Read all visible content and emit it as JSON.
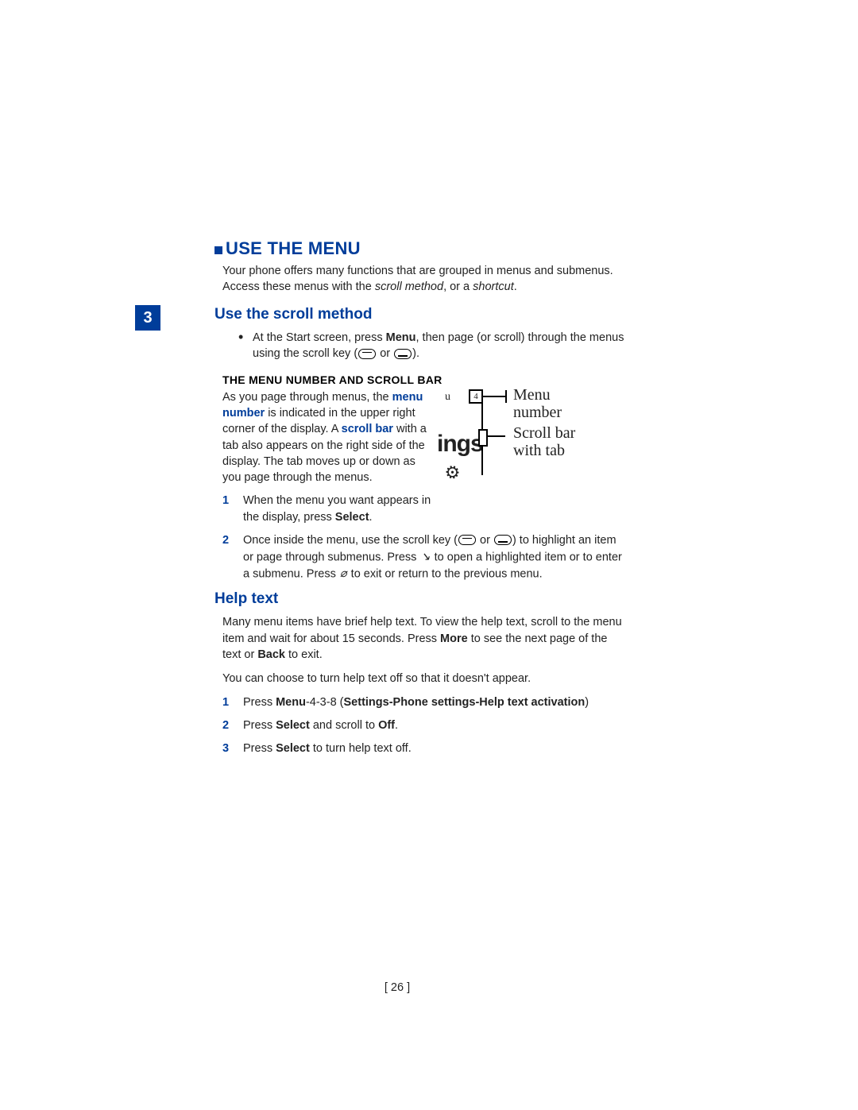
{
  "chapter_number": "3",
  "h1": "USE THE MENU",
  "intro_a": "Your phone offers many functions that are grouped in menus and submenus. Access these menus with the ",
  "intro_scroll": "scroll method",
  "intro_or": ", or a ",
  "intro_shortcut": "shortcut",
  "intro_dot": ".",
  "h2a": "Use the scroll method",
  "bullet1_a": "At the Start screen, press ",
  "bullet1_menu": "Menu",
  "bullet1_b": ", then page (or scroll) through the menus using the scroll key (",
  "bullet1_or": " or ",
  "bullet1_end": ").",
  "h3a": "THE MENU NUMBER AND SCROLL BAR",
  "p1_a": "As you page through menus, the ",
  "p1_menunum": "menu number",
  "p1_b": " is indicated in the upper right corner of the display. A ",
  "p1_scrollbar": "scroll bar",
  "p1_c": " with a tab also appears on the right side of the display. The tab moves up or down as you page through the menus.",
  "fig_u": "u",
  "fig_4": "4",
  "fig_label_menu": "Menu",
  "fig_label_number": "number",
  "fig_ings": "ings",
  "fig_label_sb1": "Scroll bar",
  "fig_label_sb2": "with tab",
  "num1_a": "When the menu you want appears in the display, press ",
  "num1_select": "Select",
  "num1_dot": ".",
  "num2_a": "Once inside the menu, use the scroll key (",
  "num2_or": " or ",
  "num2_b": ") to highlight an item or page through submenus. Press ",
  "num2_c": " to open a highlighted item or to enter a submenu. Press ",
  "num2_d": " to exit or return to the previous menu.",
  "h2b": "Help text",
  "help_p1_a": "Many menu items have brief help text. To view the help text, scroll to the menu item and wait for about 15 seconds. Press ",
  "help_more": "More",
  "help_p1_b": " to see the next page of the text or ",
  "help_back": "Back",
  "help_p1_c": " to exit.",
  "help_p2": "You can choose to turn help text off so that it doesn't appear.",
  "step1_a": "Press ",
  "step1_menu": "Menu",
  "step1_b": "-4-3-8 (",
  "step1_path": "Settings-Phone settings-Help text activation",
  "step1_c": ")",
  "step2_a": "Press ",
  "step2_select": "Select",
  "step2_b": " and scroll to ",
  "step2_off": "Off",
  "step2_dot": ".",
  "step3_a": "Press ",
  "step3_select": "Select",
  "step3_b": " to turn help text off.",
  "page_number": "[ 26 ]"
}
